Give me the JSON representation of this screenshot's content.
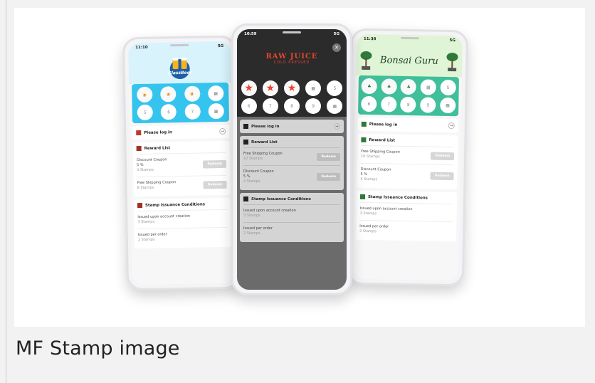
{
  "caption": "MF Stamp image",
  "colors": {
    "left_grid": "#35c4ee",
    "left_header": "#d8f3fc",
    "right_grid": "#3fbf9a",
    "right_header": "#dff5d6",
    "dark": "#2b2b2b",
    "star": "#e8442e"
  },
  "phones": {
    "left": {
      "time": "11:10",
      "signal": "5G",
      "logo_text": "GlassBeer",
      "stamps_row2": [
        "5",
        "6",
        "7",
        "8"
      ],
      "login": "Please log in",
      "reward_title": "Reward List",
      "rewards": [
        {
          "name": "Discount Coupon",
          "detail": "5 %",
          "stamps": "4 Stamps",
          "button": "Redeem"
        },
        {
          "name": "Free Shipping Coupon",
          "stamps": "8 Stamps",
          "button": "Redeem"
        }
      ],
      "conditions_title": "Stamp Issuance Conditions",
      "conditions": [
        {
          "name": "Issued upon account creation",
          "stamps": "3 Stamps"
        },
        {
          "name": "Issued per order",
          "stamps": "2 Stamps"
        }
      ]
    },
    "middle": {
      "time": "10:59",
      "signal": "5G",
      "logo_line1": "RAW JUICE",
      "logo_line2": "COLD PRESSED",
      "stamps_row1": [
        "",
        "",
        "",
        "",
        "5"
      ],
      "stamps_row2": [
        "6",
        "7",
        "8",
        "9",
        ""
      ],
      "login": "Please log in",
      "reward_title": "Reward List",
      "rewards": [
        {
          "name": "Free Shipping Coupon",
          "stamps": "10 Stamps",
          "button": "Redeem"
        },
        {
          "name": "Discount Coupon",
          "detail": "5 %",
          "stamps": "4 Stamps",
          "button": "Redeem"
        }
      ],
      "conditions_title": "Stamp Issuance Conditions",
      "conditions": [
        {
          "name": "Issued upon account creation",
          "stamps": "3 Stamps"
        },
        {
          "name": "Issued per order",
          "stamps": "2 Stamps"
        }
      ]
    },
    "right": {
      "time": "11:38",
      "signal": "5G",
      "logo_text": "Bonsai Guru",
      "stamps_row1": [
        "",
        "",
        "",
        "",
        "5"
      ],
      "stamps_row2": [
        "6",
        "7",
        "8",
        "9",
        ""
      ],
      "login": "Please log in",
      "reward_title": "Reward List",
      "rewards": [
        {
          "name": "Free Shipping Coupon",
          "stamps": "10 Stamps",
          "button": "Redeem"
        },
        {
          "name": "Discount Coupon",
          "detail": "5 %",
          "stamps": "4 Stamps",
          "button": "Redeem"
        }
      ],
      "conditions_title": "Stamp Issuance Conditions",
      "conditions": [
        {
          "name": "Issued upon account creation",
          "stamps": "3 Stamps"
        },
        {
          "name": "Issued per order",
          "stamps": "2 Stamps"
        }
      ]
    }
  }
}
